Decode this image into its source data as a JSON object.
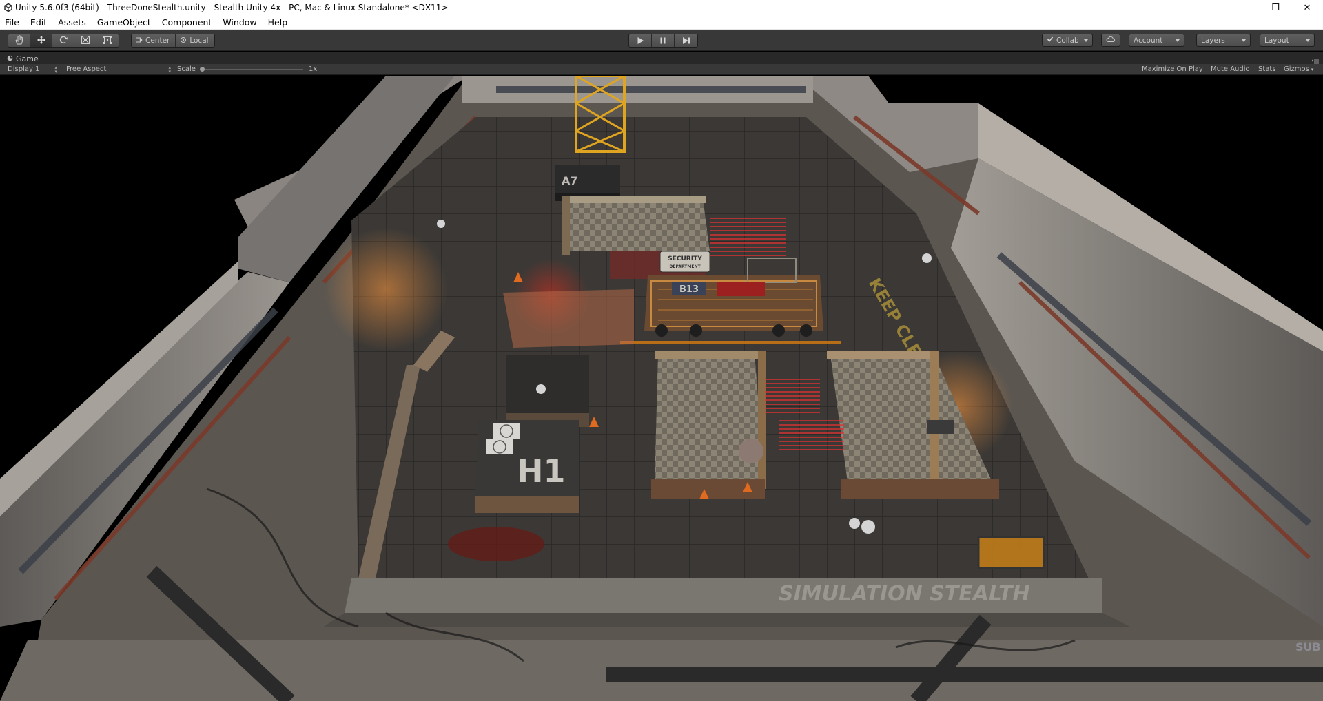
{
  "window": {
    "title": "Unity 5.6.0f3 (64bit) - ThreeDoneStealth.unity - Stealth Unity 4x - PC, Mac & Linux Standalone* <DX11>",
    "minimize_glyph": "—",
    "maximize_glyph": "❐",
    "close_glyph": "✕"
  },
  "menu": [
    "File",
    "Edit",
    "Assets",
    "GameObject",
    "Component",
    "Window",
    "Help"
  ],
  "toolbar": {
    "tools": [
      "hand-icon",
      "move-icon",
      "rotate-icon",
      "scale-icon",
      "rect-icon"
    ],
    "active_tool": "move-icon",
    "pivot_label": "Center",
    "space_label": "Local",
    "collab_label": "Collab",
    "account_label": "Account",
    "layers_label": "Layers",
    "layout_label": "Layout"
  },
  "game_tab": {
    "label": "Game",
    "display": "Display 1",
    "aspect": "Free Aspect",
    "scale_label": "Scale",
    "scale_value": "1x",
    "maximize_on_play": "Maximize On Play",
    "mute_audio": "Mute Audio",
    "stats": "Stats",
    "gizmos": "Gizmos"
  },
  "scene": {
    "labels": {
      "a7": "A7",
      "b13": "B13",
      "h1": "H1",
      "security": "SECURITY",
      "department": "DEPARTMENT",
      "keep_clear": "KEEP CLEAR",
      "simulation": "SIMULATION STEALTH",
      "sub": "SUB"
    },
    "colors": {
      "floor": "#3a3735",
      "wall": "#8d8a86",
      "laser": "#e03030",
      "accent_orange": "#d06a2a"
    }
  }
}
